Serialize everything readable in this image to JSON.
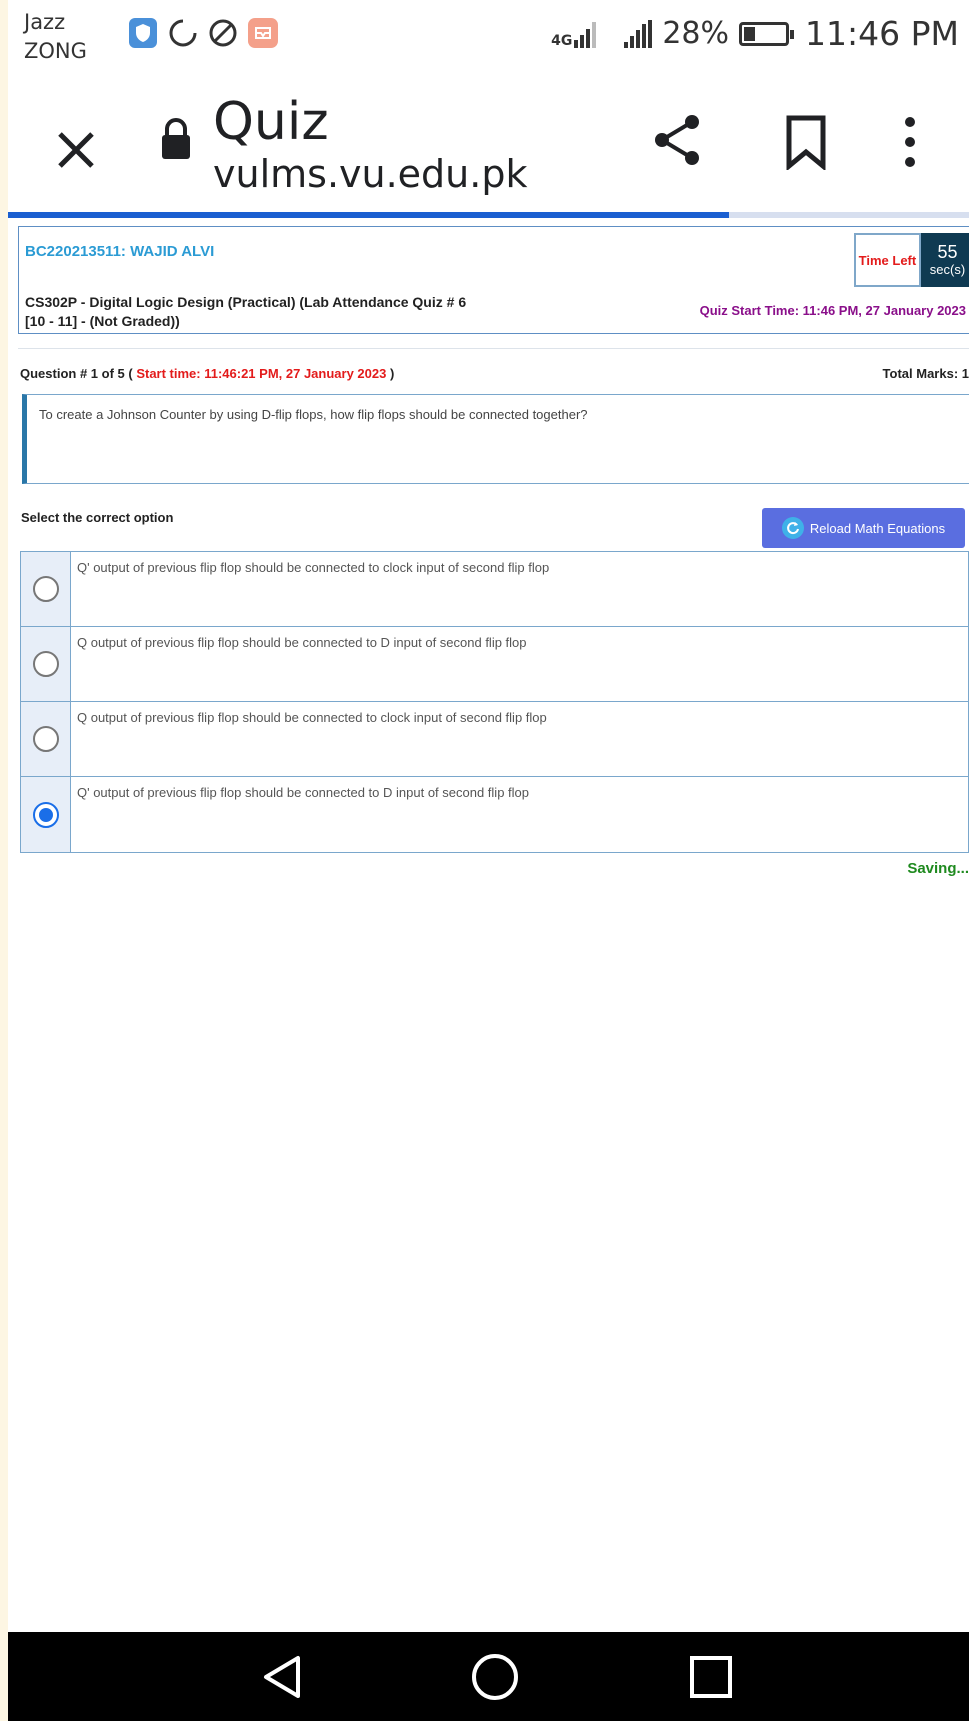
{
  "status_bar": {
    "carrier_line1": "Jazz",
    "carrier_line2": "ZONG",
    "network": "4G",
    "battery_percent": "28%",
    "battery_level": 0.28,
    "time": "11:46 PM",
    "icons": [
      "shield-icon",
      "sync-circle-icon",
      "blocked-icon",
      "app-badge-icon",
      "signal-icon",
      "battery-icon"
    ]
  },
  "browser": {
    "title": "Quiz",
    "url": "vulms.vu.edu.pk",
    "load_progress": 0.75
  },
  "quiz": {
    "student": "BC220213511: WAJID ALVI",
    "course_line1": "CS302P - Digital Logic Design (Practical) (Lab Attendance Quiz # 6",
    "course_line2": "[10 - 11] - (Not Graded))",
    "time_left_label": "Time Left",
    "time_left_value": "55",
    "time_left_unit": "sec(s)",
    "quiz_start_time": "Quiz Start Time: 11:46 PM, 27 January 2023",
    "question_prefix": "Question # 1 of 5 (",
    "question_start_time": "Start time: 11:46:21 PM, 27 January 2023",
    "question_suffix": ")",
    "total_marks": "Total Marks: 1",
    "question_text": "To create a Johnson Counter by using D-flip flops, how flip flops should be connected together?",
    "select_label": "Select the correct option",
    "reload_button": "Reload Math Equations",
    "options": [
      {
        "text": "Q' output of previous flip flop should be connected to clock input of second flip flop",
        "selected": false
      },
      {
        "text": "Q output of previous flip flop should be connected to D input of second flip flop",
        "selected": false
      },
      {
        "text": "Q output of previous flip flop should be connected to clock input of second flip flop",
        "selected": false
      },
      {
        "text": "Q' output of previous flip flop should be connected to D input of second flip flop",
        "selected": true
      }
    ],
    "saving_status": "Saving..."
  },
  "colors": {
    "accent_blue": "#1a5fd1",
    "student_blue": "#2b9bd4",
    "timer_dark": "#0f3a52",
    "alert_red": "#e31b1b",
    "start_purple": "#8a0f8a",
    "saving_green": "#1f8a1f",
    "reload_button": "#5a6ee0"
  }
}
